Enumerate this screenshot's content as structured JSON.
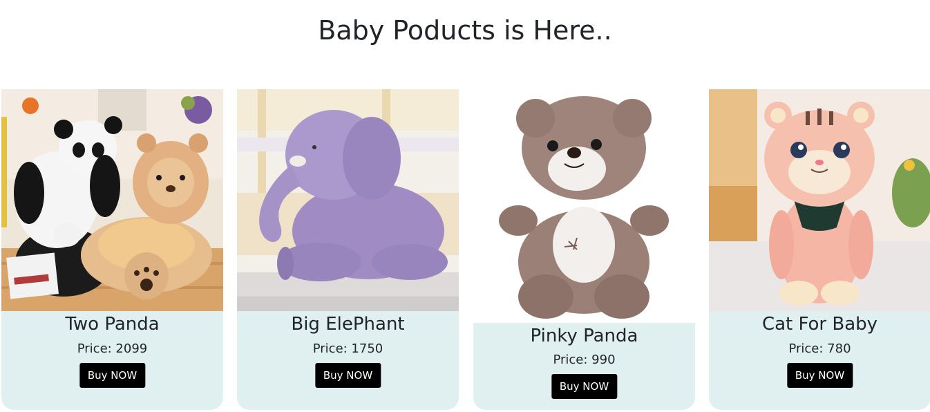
{
  "page": {
    "title": "Baby Poducts is Here.."
  },
  "products": [
    {
      "name": "Two Panda",
      "price": "Price: 2099",
      "button": "Buy NOW",
      "image": "panda-and-bear-plush-chairs"
    },
    {
      "name": "Big ElePhant",
      "price": "Price: 1750",
      "button": "Buy NOW",
      "image": "purple-elephant-plush"
    },
    {
      "name": "Pinky Panda",
      "price": "Price: 990",
      "button": "Buy NOW",
      "image": "brown-teddy-bear"
    },
    {
      "name": "Cat For Baby",
      "price": "Price: 780",
      "button": "Buy NOW",
      "image": "pink-tiger-cat-plush"
    }
  ],
  "colors": {
    "card_background": "#e0f0f1",
    "button_background": "#000000",
    "button_text": "#ffffff",
    "title_text": "#212529"
  }
}
